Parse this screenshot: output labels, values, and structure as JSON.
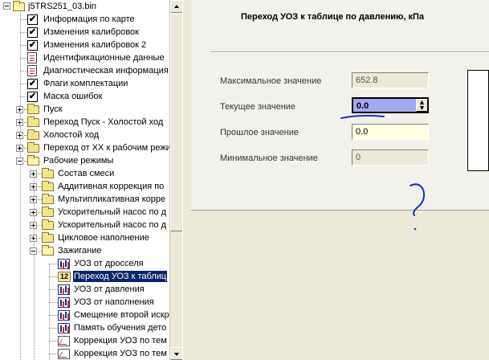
{
  "tree": {
    "root": "j5TRS251_03.bin",
    "items": [
      {
        "label": "Информация по карте",
        "icon": "checkbox-icon",
        "level": 1
      },
      {
        "label": "Изменения калибровок",
        "icon": "checkbox-icon",
        "level": 1
      },
      {
        "label": "Изменения калибровок 2",
        "icon": "checkbox-icon",
        "level": 1
      },
      {
        "label": "Идентификационные данные",
        "icon": "document-icon",
        "level": 1
      },
      {
        "label": "Диагностическая информация",
        "icon": "document-icon",
        "level": 1
      },
      {
        "label": "Флаги комплектации",
        "icon": "checkbox-icon",
        "level": 1
      },
      {
        "label": "Маска ошибок",
        "icon": "checkbox-icon",
        "level": 1
      },
      {
        "label": "Пуск",
        "icon": "folder-icon",
        "level": 1
      },
      {
        "label": "Переход Пуск - Холостой ход",
        "icon": "folder-icon",
        "level": 1
      },
      {
        "label": "Холостой ход",
        "icon": "folder-icon",
        "level": 1
      },
      {
        "label": "Переход от ХХ к рабочим режи",
        "icon": "folder-icon",
        "level": 1
      },
      {
        "label": "Рабочие режимы",
        "icon": "folder-open-icon",
        "level": 1
      },
      {
        "label": "Состав смеси",
        "icon": "folder-icon",
        "level": 2
      },
      {
        "label": "Аддитивная коррекция по",
        "icon": "folder-icon",
        "level": 2
      },
      {
        "label": "Мультипликативная корре",
        "icon": "folder-icon",
        "level": 2
      },
      {
        "label": "Ускорительный насос по д",
        "icon": "folder-icon",
        "level": 2
      },
      {
        "label": "Ускорительный насос по д",
        "icon": "folder-icon",
        "level": 2
      },
      {
        "label": "Цикловое наполнение",
        "icon": "folder-icon",
        "level": 2
      },
      {
        "label": "Зажигание",
        "icon": "folder-open-icon",
        "level": 2
      },
      {
        "label": "УОЗ от дросселя",
        "icon": "table-icon",
        "level": 3
      },
      {
        "label": "Переход УОЗ к таблиц",
        "icon": "value-icon",
        "level": 3,
        "selected": true
      },
      {
        "label": "УОЗ от давления",
        "icon": "table-icon",
        "level": 3
      },
      {
        "label": "УОЗ от наполнения",
        "icon": "table-icon",
        "level": 3
      },
      {
        "label": "Смещение второй искр",
        "icon": "table-icon",
        "level": 3
      },
      {
        "label": "Память обучения дето",
        "icon": "table-icon",
        "level": 3
      },
      {
        "label": "Коррекция УОЗ по тем",
        "icon": "curve-icon",
        "level": 3
      },
      {
        "label": "Коррекция УОЗ по тем",
        "icon": "curve-icon",
        "level": 3
      }
    ]
  },
  "form": {
    "title": "Переход УОЗ к таблице по давлению, кПа",
    "max_label": "Максимальное значение",
    "max_value": "652.8",
    "current_label": "Текущее значение",
    "current_value": "0.0",
    "previous_label": "Прошлое значение",
    "previous_value": "0.0",
    "min_label": "Минимальное значение",
    "min_value": "0"
  },
  "colors": {
    "selection": "#0a246a",
    "current_field_bg": "#a4a8f0",
    "previous_field_bg": "#ffffe0",
    "annotation_ink": "#1a2fd0"
  }
}
